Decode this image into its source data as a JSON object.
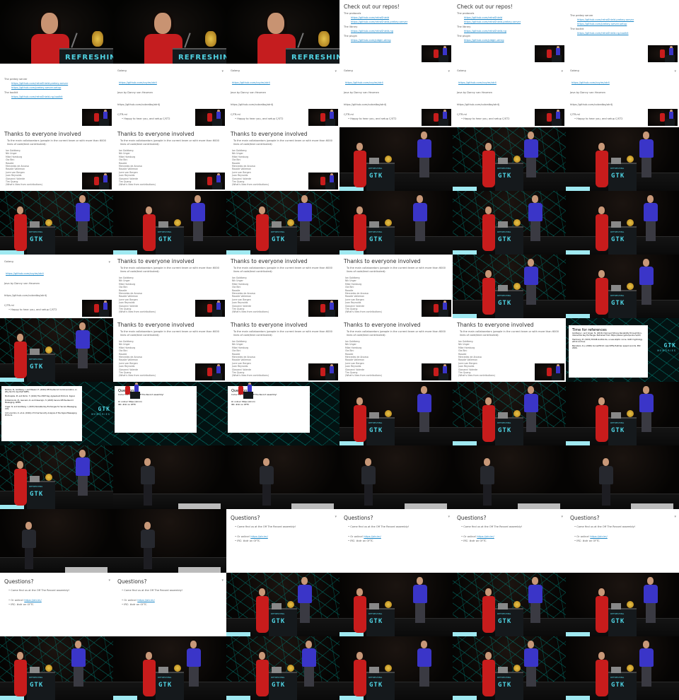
{
  "colors": {
    "link": "#1e88c8",
    "dress": "#c81c1c",
    "sweater": "#3a35c8",
    "stage_accent": "#4fd2e2",
    "floor_bar": "#9fe9f1"
  },
  "lectern_text": "REFRESHING",
  "rostrum_logo": "GTK",
  "rostrum_ribbon": "REFRESHING",
  "rostrum_sub": "MEMORIES",
  "repos": {
    "title": "Check out our repos!",
    "protocols_label": "The protocols",
    "protocols_links": [
      "https://github.com/retroShield",
      "https://github.com/retroShield-prekey-server"
    ],
    "library_label": "The library",
    "library_links": [
      "https://github.com/retroShield-ng"
    ],
    "plugin_label": "The plugin",
    "plugin_links": [
      "https://github.com/pidgin-otrng"
    ]
  },
  "servers": {
    "prekey_label": "The prekey server",
    "prekey_links": [
      "https://github.com/retroShield-prekey-server",
      "https://github.com/prekey-server-setup"
    ],
    "toolkit_label": "The toolkit",
    "toolkit_links": [
      "https://github.com/retroShield-ng-toolkit"
    ]
  },
  "golang": {
    "golang_label": "Golang",
    "golang_link": "https://github.com/coyim/otr4",
    "java_label": "Java by Danny van Heumen",
    "java_link": "https://github.com/cobratbq/otr4j",
    "c_label": "C/TR.ml",
    "c_bullet": "Happy to hear you, and setup C/ST2"
  },
  "thanks": {
    "title": "Thanks to everyone involved",
    "intro": "To the main collaborators (people in the current team or with more than 6000 lines of code/text contributed):",
    "names": [
      "Ian Goldberg",
      "Nik Unger",
      "Mike Hamburg",
      "Ola Bini",
      "Rosalie",
      "Mercedes de Ancasa",
      "Rosalie Vallemon",
      "Jurre van Bergen",
      "Juan Reynolds",
      "Giovanni Valente",
      "Tim Quang",
      "(What's likes from contributions)"
    ]
  },
  "references": {
    "title": "Time for references",
    "items": [
      "Goldberg, I. and Unger, N. (2016) Improved Strong Deniability through Non-Interactive Key Exchange. Retrieved from https://www.cypherpunks.ca/otr/",
      "Hamburg, M. (2015) Ed448-Goldilocks, a new elliptic curve. IACR Cryptology ePrint Archive.",
      "Bernstein, D.J. (2006) Curve25519: new Diffie-Hellman speed records. PKC 2006."
    ]
  },
  "references_cont": {
    "items": [
      "Borisov, N., Goldberg, I. and Brewer, E. (2004) Off-the-Record Communication, or, Why Not To Use PGP. WPES.",
      "Marlinspike, M. and Perrin, T. (2016) The X3DH Key Agreement Protocol. Signal.",
      "Di Raimondo, M., Gennaro, R. and Krawczyk, H. (2005) Secure Off-the-Record Messaging. WPES.",
      "Unger, N. and Goldberg, I. (2015) Deniable Key Exchanges for Secure Messaging. CCS.",
      "Cohn-Gordon, K. et al. (2016) A Formal Security Analysis of the Signal Messaging Protocol."
    ]
  },
  "questions": {
    "title": "Questions?",
    "bullet1": "Come find us at the Off The Record assembly!",
    "online_prefix": "Or online!",
    "online_link": "https://otr.im/",
    "irc": "IRC: #otr on OFTC"
  }
}
